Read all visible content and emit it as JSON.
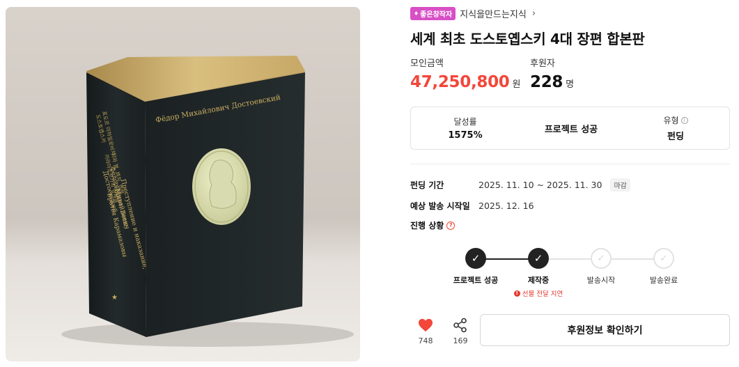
{
  "image": {
    "alt": "Dostoevsky book photo",
    "spine_title": "Фёдор Михайлович Достоевский",
    "cover_titles": [
      "Фёдор Михайлович",
      "Достоевский",
      "Преступление и наказание,",
      "Идиот, Бесы,",
      "Братья Карамазовы"
    ],
    "cover_korean": [
      "표도르 미하일로비치",
      "도스토옙스키",
      "죄와 벌, 백치, 악령,",
      "카라마조프가의 형제들"
    ]
  },
  "creator": {
    "badge": "좋은창작자",
    "name": "지식을만드는지식",
    "chevron_icon": "chevron-right-icon"
  },
  "project": {
    "title": "세계 최초 도스토옙스키 4대 장편 합본판"
  },
  "stats": {
    "amount_label": "모인금액",
    "amount_value": "47,250,800",
    "amount_unit": "원",
    "backers_label": "후원자",
    "backers_value": "228",
    "backers_unit": "명"
  },
  "summary": {
    "rate_label": "달성률",
    "rate_value": "1575%",
    "status_value": "프로젝트 성공",
    "type_label": "유형",
    "type_value": "펀딩"
  },
  "details": {
    "period_label": "펀딩 기간",
    "period_value": "2025. 11. 10 ~ 2025. 11. 30",
    "period_tag": "마감",
    "ship_label": "예상 발송 시작일",
    "ship_value": "2025. 12. 16",
    "progress_label": "진행 상황"
  },
  "progress": {
    "steps": [
      {
        "label": "프로젝트 성공",
        "state": "done"
      },
      {
        "label": "제작중",
        "state": "done",
        "note": "선물 전달 지연"
      },
      {
        "label": "발송시작",
        "state": "todo"
      },
      {
        "label": "발송완료",
        "state": "todo"
      }
    ]
  },
  "actions": {
    "like_count": "748",
    "share_count": "169",
    "cta_label": "후원정보 확인하기"
  },
  "colors": {
    "accent_red": "#f2473a",
    "badge_pink": "#d84fc6",
    "dark": "#222222"
  }
}
